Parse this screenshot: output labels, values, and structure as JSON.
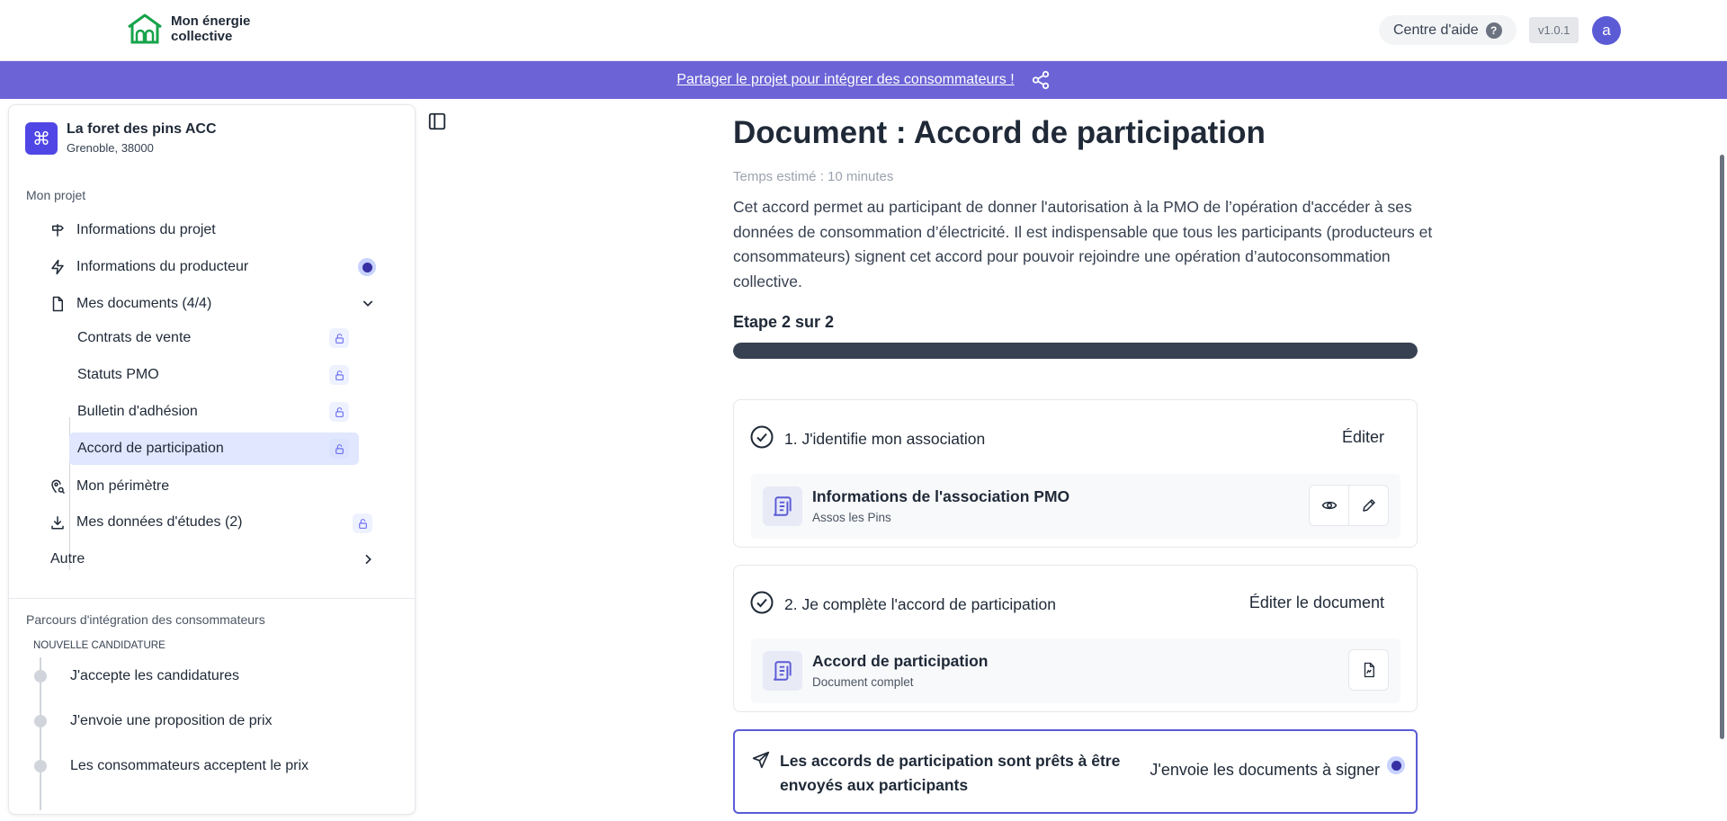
{
  "header": {
    "logo_line1": "Mon énergie",
    "logo_line2": "collective",
    "help_label": "Centre d'aide",
    "help_icon": "?",
    "version": "v1.0.1",
    "avatar_initial": "a"
  },
  "banner": {
    "link_text": "Partager le projet pour intégrer des consommateurs !",
    "icon": "share-icon"
  },
  "sidebar": {
    "project": {
      "icon": "⌘",
      "name": "La foret des pins ACC",
      "location": "Grenoble, 38000"
    },
    "section_my_project": "Mon projet",
    "items": [
      {
        "label": "Informations du projet",
        "icon": "signpost-icon"
      },
      {
        "label": "Informations du producteur",
        "icon": "lightning-icon"
      },
      {
        "label": "Mes documents (4/4)",
        "icon": "file-icon"
      },
      {
        "label": "Mon périmètre",
        "icon": "map-pin-icon"
      },
      {
        "label": "Mes données d'études (2)",
        "icon": "download-icon"
      },
      {
        "label": "Autre",
        "icon": "chevron-right-icon"
      }
    ],
    "documents": [
      {
        "label": "Contrats de vente"
      },
      {
        "label": "Statuts PMO"
      },
      {
        "label": "Bulletin d'adhésion"
      },
      {
        "label": "Accord de participation",
        "active": true
      }
    ],
    "section_onboarding": "Parcours d'intégration des consommateurs",
    "new_application_label": "NOUVELLE CANDIDATURE",
    "steps": [
      {
        "label": "J'accepte les candidatures"
      },
      {
        "label": "J'envoie une proposition de prix"
      },
      {
        "label": "Les consommateurs acceptent le prix"
      }
    ]
  },
  "main": {
    "title": "Document : Accord de participation",
    "estimated_time": "Temps estimé : 10 minutes",
    "description": "Cet accord permet au participant de donner l'autorisation à la PMO de l’opération d'accéder à ses données de consommation d’électricité. Il est indispensable que tous les participants (producteurs et consommateurs) signent cet accord pour pouvoir rejoindre une opération d’autoconsommation collective.",
    "step_label": "Etape 2 sur 2",
    "progress": 1.0,
    "cards": [
      {
        "title": "1. J'identifie mon association",
        "action": "Éditer",
        "doc_title": "Informations de l'association PMO",
        "doc_sub": "Assos les Pins"
      },
      {
        "title": "2. Je complète l'accord de participation",
        "action": "Éditer le document",
        "doc_title": "Accord de participation",
        "doc_sub": "Document complet"
      }
    ],
    "send": {
      "text": "Les accords de participation sont prêts à être envoyés aux participants",
      "button": "J'envoie les documents à signer"
    }
  },
  "colors": {
    "accent": "#5b5bd6",
    "banner": "#6b63d6",
    "progress": "#374151",
    "logo_green": "#16a34a"
  }
}
